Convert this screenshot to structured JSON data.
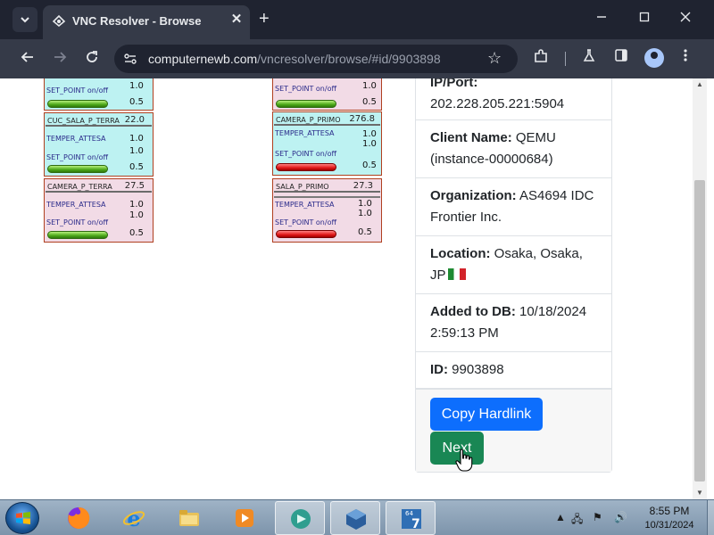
{
  "browser": {
    "tab_title": "VNC Resolver - Browse",
    "url_host": "computernewb.com",
    "url_path": "/vncresolver/browse/#id/9903898",
    "tab_menu_icon": "chevron-down-icon",
    "new_tab_symbol": "+",
    "close_symbol": "✕"
  },
  "scada": {
    "panels": [
      {
        "name": "",
        "value": "",
        "rows": [
          {
            "label": "SET_POINT on/off",
            "value": "1.0"
          },
          {
            "label": "",
            "value": "0.5"
          }
        ],
        "indicator": "green"
      },
      {
        "name": "CUC_SALA_P_TERRA",
        "value": "22.0",
        "rows": [
          {
            "label": "TEMPER_ATTESA",
            "value": "1.0"
          },
          {
            "label": "",
            "value": "1.0"
          },
          {
            "label": "SET_POINT on/off",
            "value": "0.5"
          }
        ],
        "indicator": "green"
      },
      {
        "name": "CAMERA_P_TERRA",
        "value": "27.5",
        "rows": [
          {
            "label": "TEMPER_ATTESA",
            "value": "1.0"
          },
          {
            "label": "",
            "value": "1.0"
          },
          {
            "label": "SET_POINT on/off",
            "value": "0.5"
          }
        ],
        "indicator": "green"
      },
      {
        "name": "",
        "value": "",
        "rows": [
          {
            "label": "SET_POINT on/off",
            "value": "1.0"
          },
          {
            "label": "",
            "value": "0.5"
          }
        ],
        "indicator": "green"
      },
      {
        "name": "CAMERA_P_PRIMO",
        "value": "276.8",
        "rows": [
          {
            "label": "TEMPER_ATTESA",
            "value": "1.0"
          },
          {
            "label": "",
            "value": "1.0"
          },
          {
            "label": "SET_POINT on/off",
            "value": "0.5"
          }
        ],
        "indicator": "red"
      },
      {
        "name": "SALA_P_PRIMO",
        "value": "27.3",
        "rows": [
          {
            "label": "TEMPER_ATTESA",
            "value": "1.0"
          },
          {
            "label": "",
            "value": "1.0"
          },
          {
            "label": "SET_POINT on/off",
            "value": "0.5"
          }
        ],
        "indicator": "red"
      }
    ]
  },
  "card": {
    "ip_label": "IP/Port:",
    "ip_value": "202.228.205.221:5904",
    "client_label": "Client Name:",
    "client_value": "QEMU (instance-00000684)",
    "org_label": "Organization:",
    "org_value": "AS4694 IDC Frontier Inc.",
    "location_label": "Location:",
    "location_value": "Osaka, Osaka, JP",
    "added_label": "Added to DB:",
    "added_value": "10/18/2024 2:59:13 PM",
    "id_label": "ID:",
    "id_value": "9903898",
    "copy_button": "Copy Hardlink",
    "next_button": "Next",
    "colors": {
      "primary": "#0d6efd",
      "success": "#198754"
    }
  },
  "taskbar": {
    "time": "8:55 PM",
    "date": "10/31/2024",
    "apps": [
      "firefox-icon",
      "internet-explorer-icon",
      "file-explorer-icon",
      "media-player-icon",
      "vnc-viewer-icon",
      "virtualbox-icon",
      "windows7-iso-icon"
    ]
  }
}
